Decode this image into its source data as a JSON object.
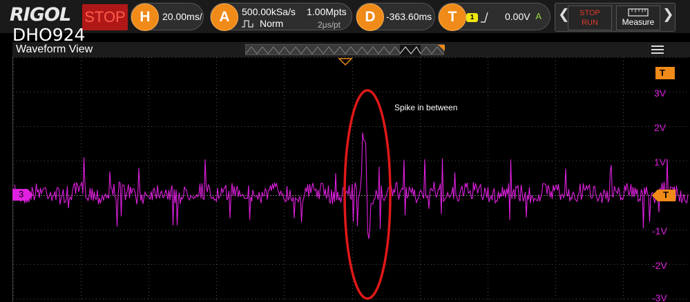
{
  "header": {
    "brand": "RIGOL",
    "model": "DHO924",
    "run_state": "STOP"
  },
  "horizontal": {
    "letter": "H",
    "timebase": "20.00ms/"
  },
  "acquire": {
    "letter": "A",
    "sample_rate": "500.00kSa/s",
    "memory_depth": "1.00Mpts",
    "mode": "Norm",
    "resolution": "2μs/pt"
  },
  "delay": {
    "letter": "D",
    "offset": "-363.60ms"
  },
  "trigger": {
    "letter": "T",
    "source_channel": "1",
    "level": "0.00V",
    "sweep_mode": "A"
  },
  "controls": {
    "stop_run_line1": "STOP",
    "stop_run_line2": "RUN",
    "measure_label": "Measure"
  },
  "view": {
    "title": "Waveform View"
  },
  "channel": {
    "number": "3",
    "color": "#e020e0"
  },
  "trigger_marker": {
    "label": "T",
    "color": "#f08a18"
  },
  "volt_labels": [
    "3V",
    "2V",
    "1V",
    "-1V",
    "-2V",
    "-3V"
  ],
  "annotation": {
    "text": "Spike in between",
    "ring_color": "#e01818"
  },
  "icons": {
    "edge": "rising-edge-icon",
    "acquire_mode": "pulse-icon",
    "measure": "ruler-icon",
    "menu": "hamburger-icon"
  }
}
